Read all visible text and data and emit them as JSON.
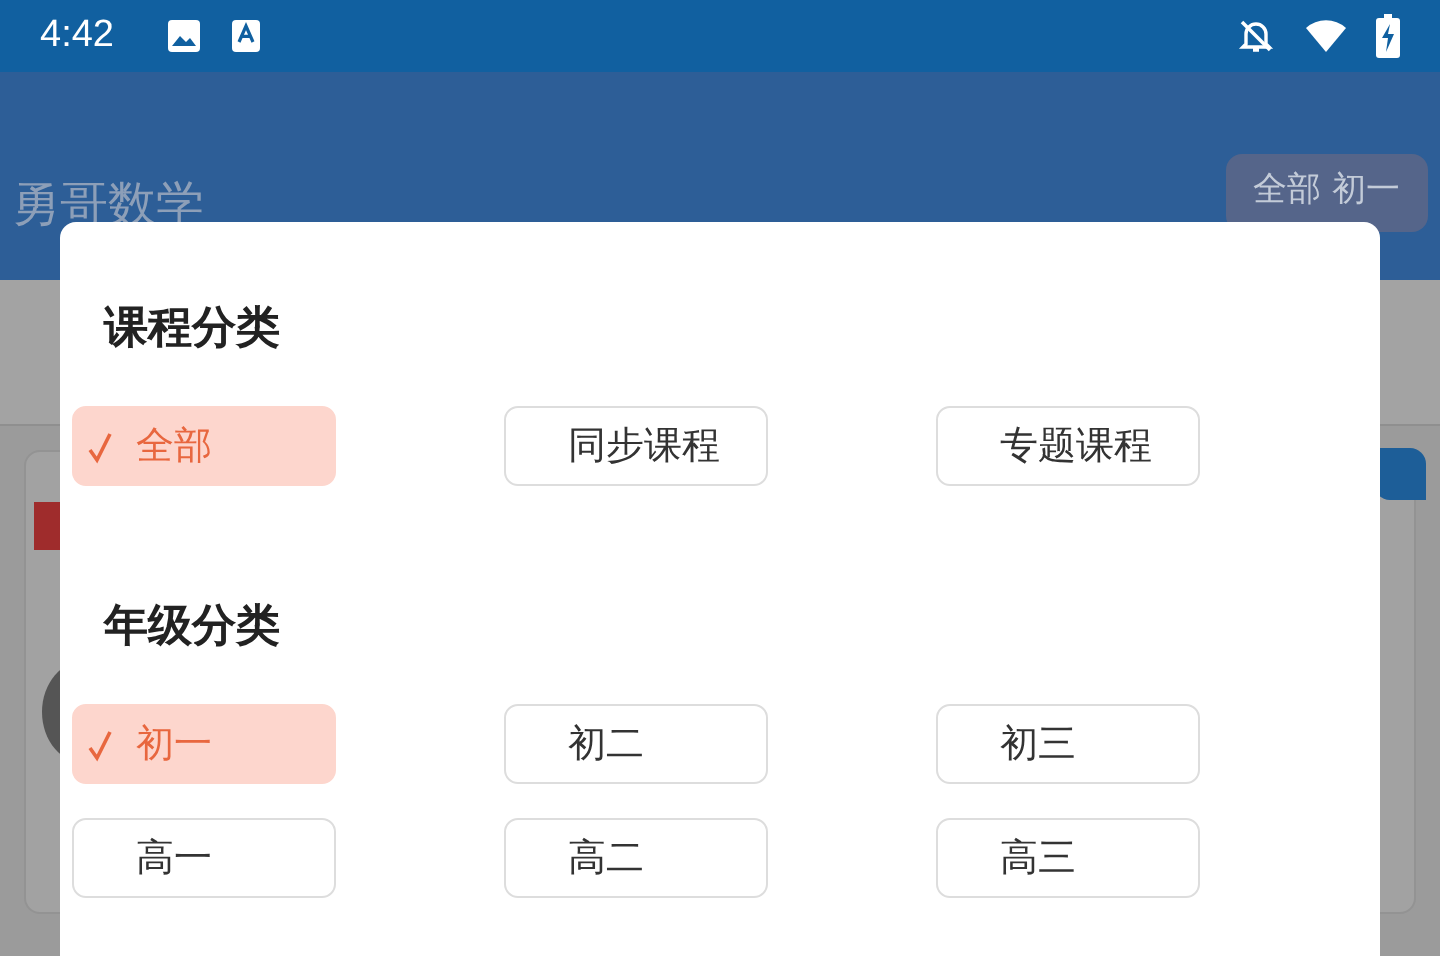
{
  "status_bar": {
    "time": "4:42"
  },
  "app_bar": {
    "title": "勇哥数学",
    "filter_button": "全部 初一"
  },
  "dialog": {
    "sections": [
      {
        "title": "课程分类",
        "options": [
          {
            "label": "全部",
            "selected": true
          },
          {
            "label": "同步课程",
            "selected": false
          },
          {
            "label": "专题课程",
            "selected": false
          }
        ]
      },
      {
        "title": "年级分类",
        "options": [
          {
            "label": "初一",
            "selected": true
          },
          {
            "label": "初二",
            "selected": false
          },
          {
            "label": "初三",
            "selected": false
          },
          {
            "label": "高一",
            "selected": false
          },
          {
            "label": "高二",
            "selected": false
          },
          {
            "label": "高三",
            "selected": false
          }
        ]
      }
    ]
  }
}
